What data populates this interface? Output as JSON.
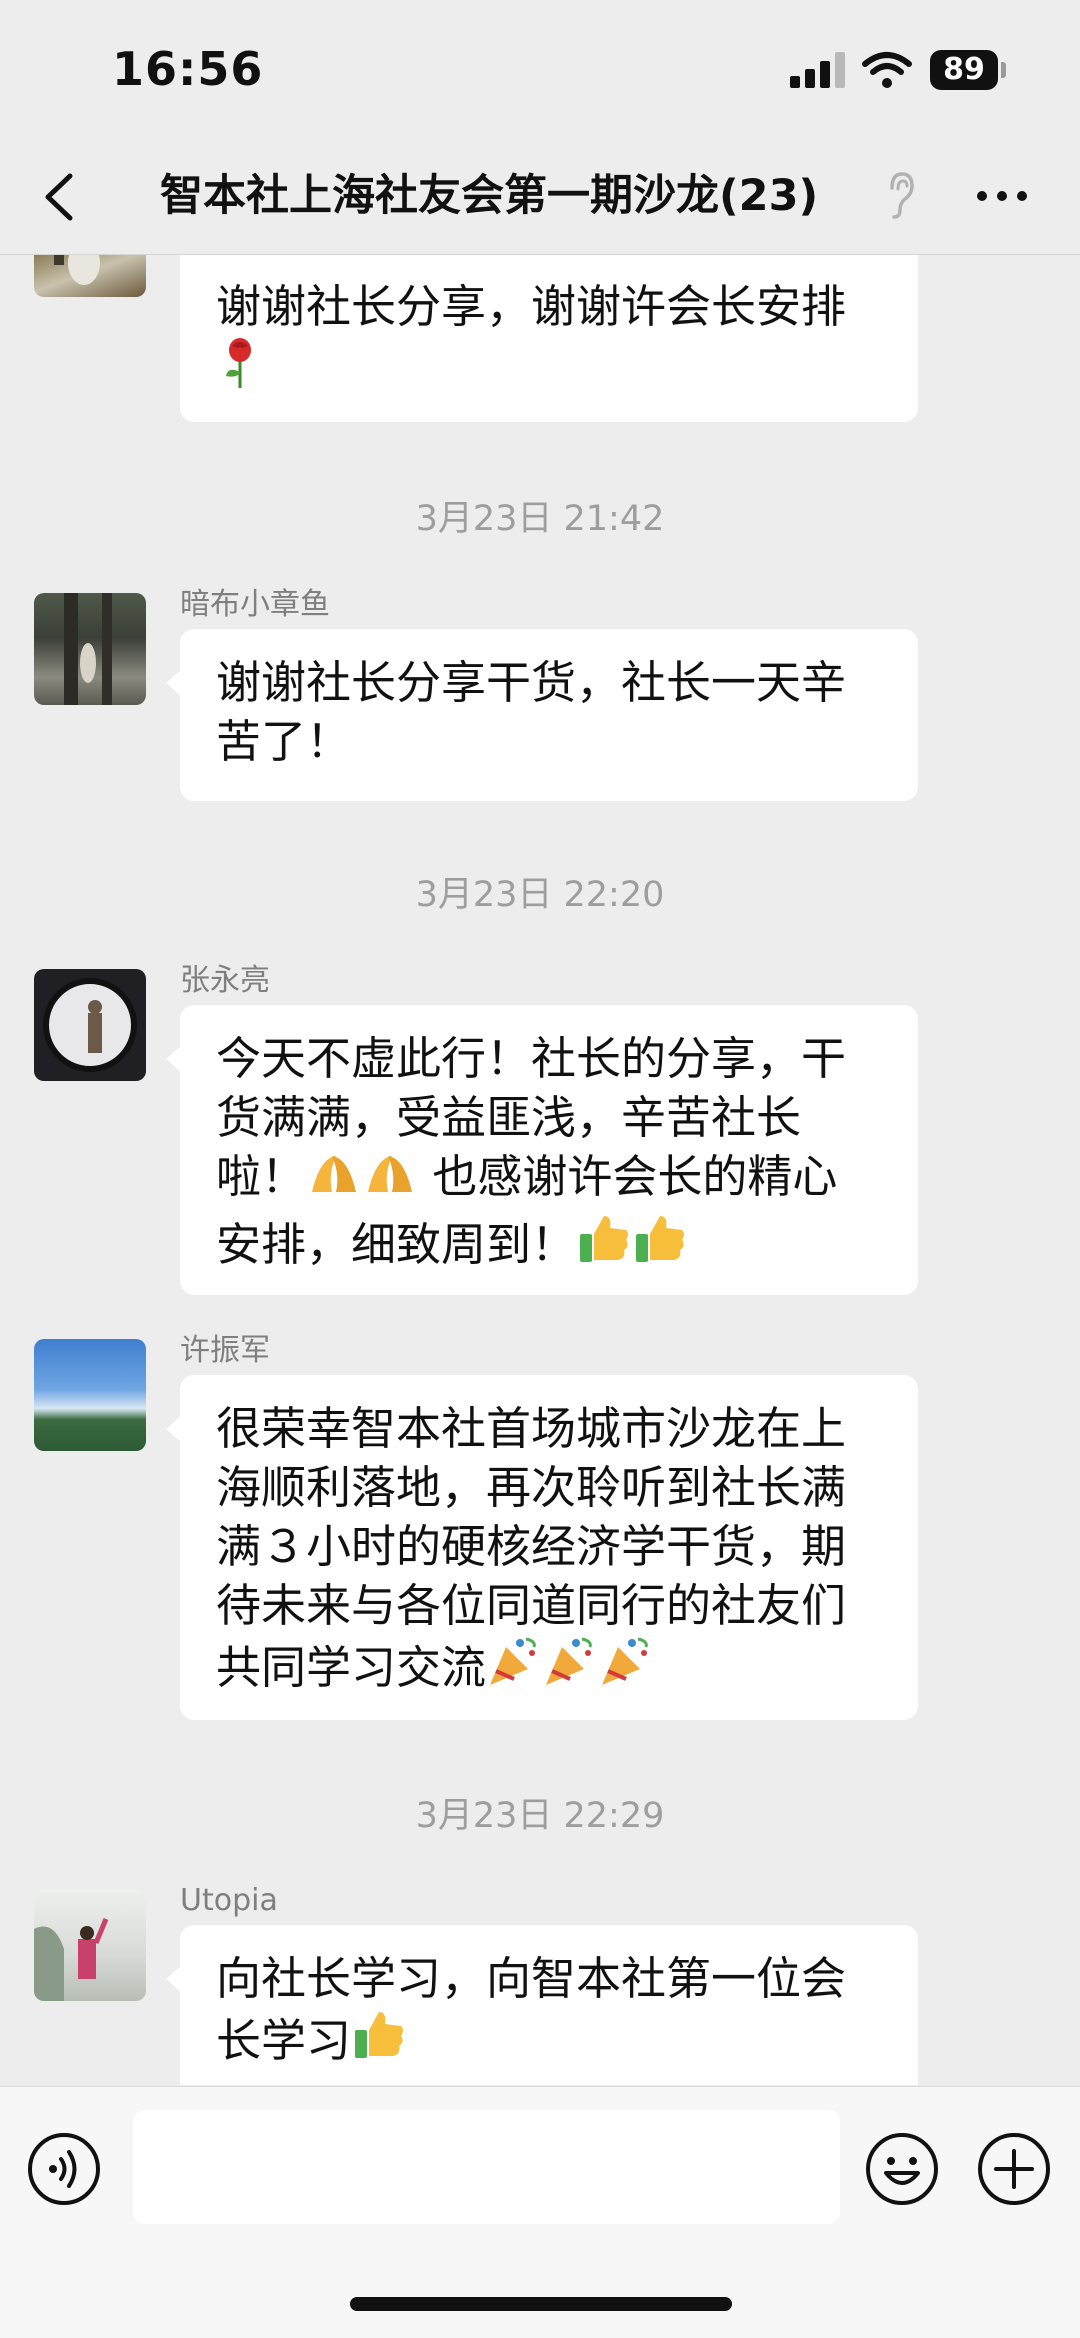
{
  "status_bar": {
    "time": "16:56",
    "battery": "89"
  },
  "nav": {
    "title": "智本社上海社友会第一期沙龙(23)"
  },
  "messages": [
    {
      "type": "message",
      "sender": "",
      "text": "谢谢社长分享，谢谢许会长安排",
      "emoji": "rose"
    },
    {
      "type": "time",
      "text": "3月23日 21:42"
    },
    {
      "type": "message",
      "sender": "暗布小章鱼",
      "text": "谢谢社长分享干货，社长一天辛苦了！"
    },
    {
      "type": "time",
      "text": "3月23日 22:20"
    },
    {
      "type": "message",
      "sender": "张永亮",
      "text_a": "今天不虚此行！社长的分享，干货满满，受益匪浅，辛苦社长啦！",
      "text_b": " 也感谢许会长的精心安排，细致周到！",
      "emojis_a": [
        "folded-hands",
        "folded-hands"
      ],
      "emojis_b": [
        "thumbs-up",
        "thumbs-up"
      ]
    },
    {
      "type": "message",
      "sender": "许振军",
      "text": "很荣幸智本社首场城市沙龙在上海顺利落地，再次聆听到社长满满３小时的硬核经济学干货，期待未来与各位同道同行的社友们共同学习交流",
      "emojis": [
        "party-popper",
        "party-popper",
        "party-popper"
      ]
    },
    {
      "type": "time",
      "text": "3月23日 22:29"
    },
    {
      "type": "message",
      "sender": "Utopia",
      "text": "向社长学习，向智本社第一位会长学习",
      "emojis": [
        "thumbs-up"
      ]
    }
  ],
  "colors": {
    "background": "#ededed",
    "bubble": "#ffffff",
    "meta_text": "#9e9e9e"
  }
}
